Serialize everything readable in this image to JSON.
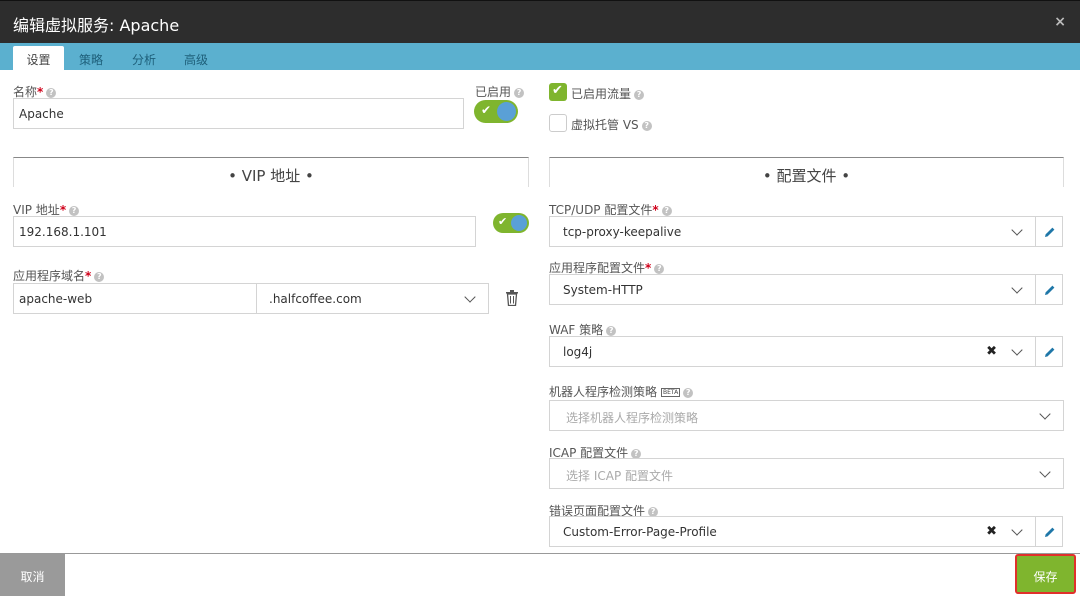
{
  "window": {
    "title": "编辑虚拟服务: Apache",
    "close_glyph": "×"
  },
  "tabs": [
    {
      "label": "设置",
      "active": true
    },
    {
      "label": "策略",
      "active": false
    },
    {
      "label": "分析",
      "active": false
    },
    {
      "label": "高级",
      "active": false
    }
  ],
  "left": {
    "name_label": "名称",
    "name_value": "Apache",
    "enabled_label": "已启用",
    "vip_section_title": "• VIP 地址 •",
    "vip_label": "VIP 地址",
    "vip_value": "192.168.1.101",
    "domain_label": "应用程序域名",
    "domain_host": "apache-web",
    "domain_suffix": ".halfcoffee.com"
  },
  "right": {
    "traffic_enabled_label": "已启用流量",
    "virtual_hosted_label": "虚拟托管 VS",
    "profile_section_title": "• 配置文件 •",
    "tcp_label": "TCP/UDP 配置文件",
    "tcp_value": "tcp-proxy-keepalive",
    "app_profile_label": "应用程序配置文件",
    "app_profile_value": "System-HTTP",
    "waf_label": "WAF 策略",
    "waf_value": "log4j",
    "bot_label": "机器人程序检测策略",
    "bot_beta": "BETA",
    "bot_placeholder": "选择机器人程序检测策略",
    "icap_label": "ICAP 配置文件",
    "icap_placeholder": "选择 ICAP 配置文件",
    "error_page_label": "错误页面配置文件",
    "error_page_value": "Custom-Error-Page-Profile"
  },
  "footer": {
    "cancel_label": "取消",
    "save_label": "保存"
  },
  "colors": {
    "accent_green": "#7fb52e",
    "tab_blue": "#5bb0cf",
    "titlebar": "#2d2d2d",
    "required": "#d0021b",
    "save_highlight": "#e0302b"
  }
}
